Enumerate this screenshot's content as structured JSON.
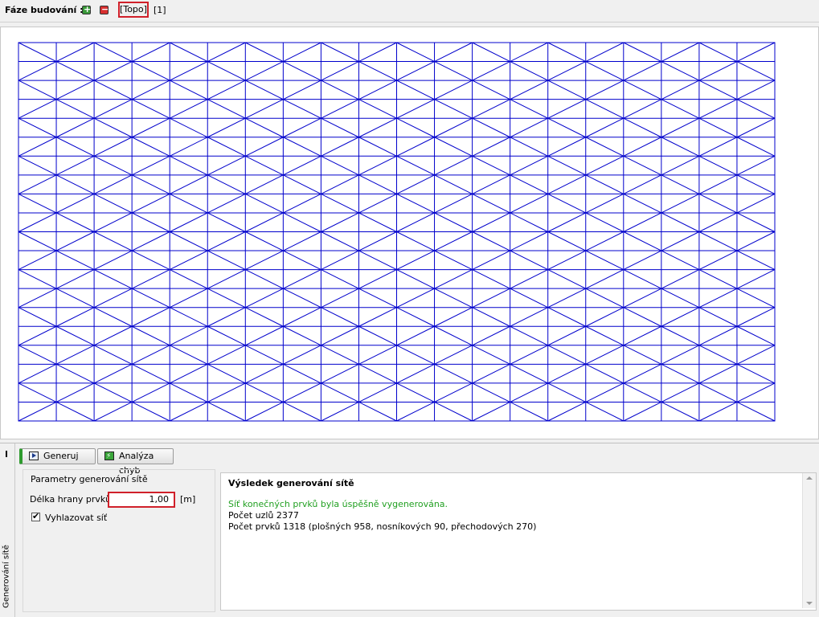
{
  "header": {
    "label": "Fáze budování :",
    "add_icon": "plus-icon",
    "remove_icon": "minus-icon",
    "stages": [
      "[Topo]",
      "[1]"
    ]
  },
  "mesh": {
    "color": "#0000cc",
    "cols": 20,
    "rows": 10
  },
  "tabs": {
    "generate_label": "Generuj",
    "analysis_label": "Analýza chyb",
    "side_label": "Generování sítě"
  },
  "params": {
    "title": "Parametry generování sítě",
    "length_label": "Délka hrany prvků",
    "length_value": "1,00",
    "length_unit": "[m]",
    "smooth_label": "Vyhlazovat síť",
    "smooth_checked": true
  },
  "result": {
    "title": "Výsledek generování sítě",
    "success": "Síť konečných prvků byla úspěšně vygenerována.",
    "nodes": "Počet uzlů 2377",
    "elements": "Počet prvků 1318 (plošných 958, nosníkových 90, přechodových 270)"
  }
}
